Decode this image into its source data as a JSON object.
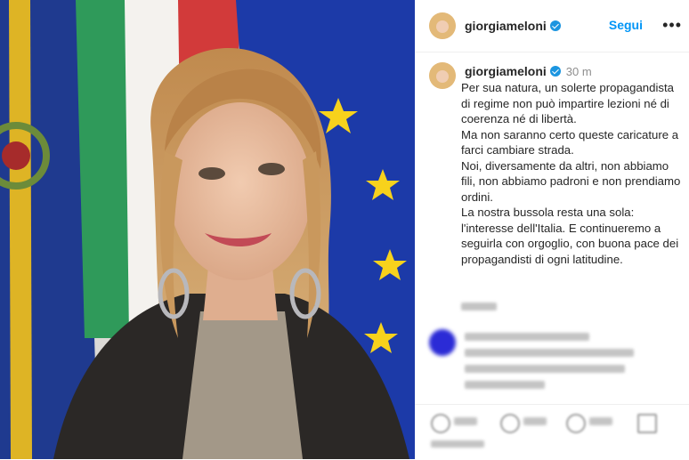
{
  "post": {
    "username": "giorgiameloni",
    "follow_label": "Segui",
    "more_icon": "ellipsis-icon",
    "verified_icon": "verified-badge-icon",
    "time_ago": "30 m",
    "caption_lines": [
      "Per sua natura, un solerte propagandista di regime non può impartire lezioni né di coerenza né di libertà.",
      "Ma non saranno certo queste caricature a farci cambiare strada.",
      "Noi, diversamente da altri, non abbiamo fili, non abbiamo padroni e non prendiamo ordini.",
      "La nostra bussola resta una sola: l'interesse dell'Italia. E continueremo a seguirla con orgoglio, con buona pace dei propagandisti di ogni latitudine."
    ]
  },
  "colors": {
    "link_blue": "#0095f6",
    "verified_blue": "#1b95e0",
    "text": "#262626",
    "muted": "#8e8e8e"
  }
}
